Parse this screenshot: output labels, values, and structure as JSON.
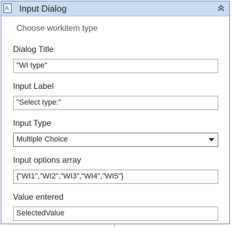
{
  "header": {
    "title": "Input Dialog",
    "icon": "activity-icon",
    "collapse_icon": "double-chevron-up-icon"
  },
  "subtitle": "Choose workitem type",
  "fields": {
    "dialog_title": {
      "label": "Dialog Title",
      "value": "\"WI type\""
    },
    "input_label": {
      "label": "Input Label",
      "value": "\"Select type:\""
    },
    "input_type": {
      "label": "Input Type",
      "value": "Multiple Choice"
    },
    "options_array": {
      "label": "Input options array",
      "value": "{\"WI1\",\"WI2\",\"WI3\",\"WI4\",\"WI5\"}"
    },
    "value_entered": {
      "label": "Value entered",
      "value": "SelectedValue"
    }
  },
  "colors": {
    "header_bg": "#c8dcf3",
    "border": "#6f8fc0"
  }
}
